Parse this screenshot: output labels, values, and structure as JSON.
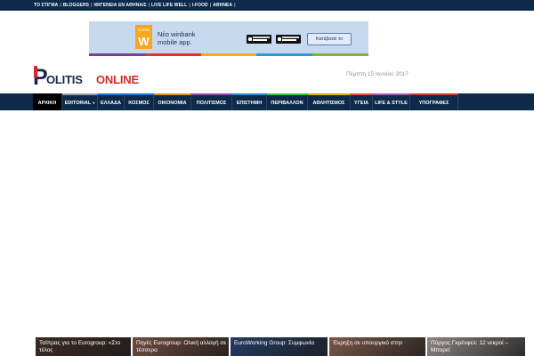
{
  "topbar": {
    "links": [
      "ΤΟ ΣΤΙΓΜΑ",
      "BLOGGERS",
      "ΙΦΙΓΕΝΕΙΑ ΕΝ ΑΘΗΝΑΙΣ",
      "LIVE LIFE WELL",
      "I-FOOD",
      "ΑΘΗΝΕΑ"
    ],
    "separator": "|"
  },
  "ad": {
    "logo_top": "mobile",
    "logo_mark": "W",
    "line1": "Νέο winbank",
    "line2": "mobile app.",
    "cta": "Κατέβασέ το",
    "stripe_colors": [
      "#7b3f98",
      "#e4352d",
      "#f7a823",
      "#2a9ad6",
      "#7cb342"
    ]
  },
  "logo": {
    "p": "P",
    "politis": "OLITIS",
    "online": "ONLINE",
    "colors": {
      "navy": "#16294c",
      "red": "#d62a2a"
    }
  },
  "date": "Πέμπτη 15 Ιουνίου 2017",
  "nav": {
    "items": [
      {
        "label": "ΑΡΧΙΚΗ",
        "active": true,
        "accent": "#000000"
      },
      {
        "label": "EDITORIAL",
        "has_dropdown": true,
        "accent": "#9a9a9a"
      },
      {
        "label": "ΕΛΛΑΔΑ",
        "accent": "#1f6fd1"
      },
      {
        "label": "ΚΟΣΜΟΣ",
        "accent": "#1f6fd1"
      },
      {
        "label": "ΟΙΚΟΝΟΜΙΑ",
        "accent": "#e08a1e"
      },
      {
        "label": "ΠΟΛΙΤΙΣΜΟΣ",
        "accent": "#8e44ad"
      },
      {
        "label": "ΕΠΙΣΤΗΜΗ",
        "accent": "#2e86c1"
      },
      {
        "label": "ΠΕΡΙΒΑΛΛΟΝ",
        "accent": "#2ecc40"
      },
      {
        "label": "ΑΘΛΗΤΙΣΜΟΣ",
        "accent": "#d4ac0d"
      },
      {
        "label": "ΥΓΕΙΑ",
        "accent": "#e74c3c"
      },
      {
        "label": "LIFE & STYLE",
        "accent": "#9b59b6"
      },
      {
        "label": "ΥΠΟΓΡΑΦΕΣ",
        "accent": "#c0392b"
      }
    ],
    "background": "#0e2a4a"
  },
  "news_cards": [
    {
      "title": "Τσίπρας για το Eurogroup: «Στο τέλος",
      "bg": "#3b2a23"
    },
    {
      "title": "Πηγές Eurogroup: Ολική αλλαγή σε τέσσερα",
      "bg": "#6e4a3c"
    },
    {
      "title": "EuroWorking Group: Συμφωνία",
      "bg": "#233a63"
    },
    {
      "title": "Έκρηξη σε υπουργικό στην",
      "bg": "#7a5648"
    },
    {
      "title": "Πύργος Γκρένφελ: 12 νεκροί – Μπορεί",
      "bg": "#8a8480"
    }
  ]
}
